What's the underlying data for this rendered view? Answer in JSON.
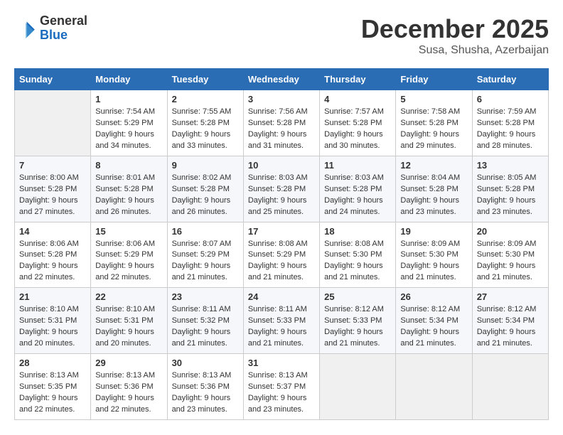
{
  "header": {
    "logo_general": "General",
    "logo_blue": "Blue",
    "month": "December 2025",
    "location": "Susa, Shusha, Azerbaijan"
  },
  "weekdays": [
    "Sunday",
    "Monday",
    "Tuesday",
    "Wednesday",
    "Thursday",
    "Friday",
    "Saturday"
  ],
  "weeks": [
    [
      {
        "day": "",
        "empty": true
      },
      {
        "day": "1",
        "sunrise": "7:54 AM",
        "sunset": "5:29 PM",
        "daylight": "9 hours and 34 minutes."
      },
      {
        "day": "2",
        "sunrise": "7:55 AM",
        "sunset": "5:28 PM",
        "daylight": "9 hours and 33 minutes."
      },
      {
        "day": "3",
        "sunrise": "7:56 AM",
        "sunset": "5:28 PM",
        "daylight": "9 hours and 31 minutes."
      },
      {
        "day": "4",
        "sunrise": "7:57 AM",
        "sunset": "5:28 PM",
        "daylight": "9 hours and 30 minutes."
      },
      {
        "day": "5",
        "sunrise": "7:58 AM",
        "sunset": "5:28 PM",
        "daylight": "9 hours and 29 minutes."
      },
      {
        "day": "6",
        "sunrise": "7:59 AM",
        "sunset": "5:28 PM",
        "daylight": "9 hours and 28 minutes."
      }
    ],
    [
      {
        "day": "7",
        "sunrise": "8:00 AM",
        "sunset": "5:28 PM",
        "daylight": "9 hours and 27 minutes."
      },
      {
        "day": "8",
        "sunrise": "8:01 AM",
        "sunset": "5:28 PM",
        "daylight": "9 hours and 26 minutes."
      },
      {
        "day": "9",
        "sunrise": "8:02 AM",
        "sunset": "5:28 PM",
        "daylight": "9 hours and 26 minutes."
      },
      {
        "day": "10",
        "sunrise": "8:03 AM",
        "sunset": "5:28 PM",
        "daylight": "9 hours and 25 minutes."
      },
      {
        "day": "11",
        "sunrise": "8:03 AM",
        "sunset": "5:28 PM",
        "daylight": "9 hours and 24 minutes."
      },
      {
        "day": "12",
        "sunrise": "8:04 AM",
        "sunset": "5:28 PM",
        "daylight": "9 hours and 23 minutes."
      },
      {
        "day": "13",
        "sunrise": "8:05 AM",
        "sunset": "5:28 PM",
        "daylight": "9 hours and 23 minutes."
      }
    ],
    [
      {
        "day": "14",
        "sunrise": "8:06 AM",
        "sunset": "5:28 PM",
        "daylight": "9 hours and 22 minutes."
      },
      {
        "day": "15",
        "sunrise": "8:06 AM",
        "sunset": "5:29 PM",
        "daylight": "9 hours and 22 minutes."
      },
      {
        "day": "16",
        "sunrise": "8:07 AM",
        "sunset": "5:29 PM",
        "daylight": "9 hours and 21 minutes."
      },
      {
        "day": "17",
        "sunrise": "8:08 AM",
        "sunset": "5:29 PM",
        "daylight": "9 hours and 21 minutes."
      },
      {
        "day": "18",
        "sunrise": "8:08 AM",
        "sunset": "5:30 PM",
        "daylight": "9 hours and 21 minutes."
      },
      {
        "day": "19",
        "sunrise": "8:09 AM",
        "sunset": "5:30 PM",
        "daylight": "9 hours and 21 minutes."
      },
      {
        "day": "20",
        "sunrise": "8:09 AM",
        "sunset": "5:30 PM",
        "daylight": "9 hours and 21 minutes."
      }
    ],
    [
      {
        "day": "21",
        "sunrise": "8:10 AM",
        "sunset": "5:31 PM",
        "daylight": "9 hours and 20 minutes."
      },
      {
        "day": "22",
        "sunrise": "8:10 AM",
        "sunset": "5:31 PM",
        "daylight": "9 hours and 20 minutes."
      },
      {
        "day": "23",
        "sunrise": "8:11 AM",
        "sunset": "5:32 PM",
        "daylight": "9 hours and 21 minutes."
      },
      {
        "day": "24",
        "sunrise": "8:11 AM",
        "sunset": "5:33 PM",
        "daylight": "9 hours and 21 minutes."
      },
      {
        "day": "25",
        "sunrise": "8:12 AM",
        "sunset": "5:33 PM",
        "daylight": "9 hours and 21 minutes."
      },
      {
        "day": "26",
        "sunrise": "8:12 AM",
        "sunset": "5:34 PM",
        "daylight": "9 hours and 21 minutes."
      },
      {
        "day": "27",
        "sunrise": "8:12 AM",
        "sunset": "5:34 PM",
        "daylight": "9 hours and 21 minutes."
      }
    ],
    [
      {
        "day": "28",
        "sunrise": "8:13 AM",
        "sunset": "5:35 PM",
        "daylight": "9 hours and 22 minutes."
      },
      {
        "day": "29",
        "sunrise": "8:13 AM",
        "sunset": "5:36 PM",
        "daylight": "9 hours and 22 minutes."
      },
      {
        "day": "30",
        "sunrise": "8:13 AM",
        "sunset": "5:36 PM",
        "daylight": "9 hours and 23 minutes."
      },
      {
        "day": "31",
        "sunrise": "8:13 AM",
        "sunset": "5:37 PM",
        "daylight": "9 hours and 23 minutes."
      },
      {
        "day": "",
        "empty": true
      },
      {
        "day": "",
        "empty": true
      },
      {
        "day": "",
        "empty": true
      }
    ]
  ]
}
